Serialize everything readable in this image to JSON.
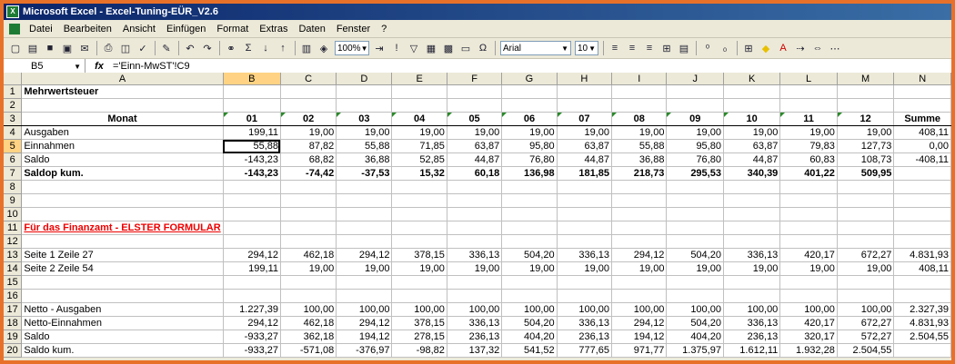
{
  "window": {
    "title": "Microsoft Excel - Excel-Tuning-EÜR_V2.6"
  },
  "menu": [
    "Datei",
    "Bearbeiten",
    "Ansicht",
    "Einfügen",
    "Format",
    "Extras",
    "Daten",
    "Fenster",
    "?"
  ],
  "toolbar": {
    "zoom": "100%",
    "font": "Arial",
    "font_size": "10"
  },
  "formula_bar": {
    "cell_ref": "B5",
    "fx": "fx",
    "formula": "='Einn-MwST'!C9"
  },
  "columns": [
    "A",
    "B",
    "C",
    "D",
    "E",
    "F",
    "G",
    "H",
    "I",
    "J",
    "K",
    "L",
    "M",
    "N"
  ],
  "selected": {
    "column": "B",
    "row": "5"
  },
  "rows": [
    {
      "n": "1",
      "cells": [
        "Mehrwertsteuer",
        "",
        "",
        "",
        "",
        "",
        "",
        "",
        "",
        "",
        "",
        "",
        "",
        ""
      ]
    },
    {
      "n": "2",
      "cells": [
        "",
        "",
        "",
        "",
        "",
        "",
        "",
        "",
        "",
        "",
        "",
        "",
        "",
        ""
      ]
    },
    {
      "n": "3",
      "cells": [
        "Monat",
        "01",
        "02",
        "03",
        "04",
        "05",
        "06",
        "07",
        "08",
        "09",
        "10",
        "11",
        "12",
        "Summe"
      ]
    },
    {
      "n": "4",
      "cells": [
        "Ausgaben",
        "199,11",
        "19,00",
        "19,00",
        "19,00",
        "19,00",
        "19,00",
        "19,00",
        "19,00",
        "19,00",
        "19,00",
        "19,00",
        "19,00",
        "408,11"
      ]
    },
    {
      "n": "5",
      "cells": [
        "Einnahmen",
        "55,88",
        "87,82",
        "55,88",
        "71,85",
        "63,87",
        "95,80",
        "63,87",
        "55,88",
        "95,80",
        "63,87",
        "79,83",
        "127,73",
        "0,00"
      ]
    },
    {
      "n": "6",
      "cells": [
        "Saldo",
        "-143,23",
        "68,82",
        "36,88",
        "52,85",
        "44,87",
        "76,80",
        "44,87",
        "36,88",
        "76,80",
        "44,87",
        "60,83",
        "108,73",
        "-408,11"
      ]
    },
    {
      "n": "7",
      "cells": [
        "Saldop kum.",
        "-143,23",
        "-74,42",
        "-37,53",
        "15,32",
        "60,18",
        "136,98",
        "181,85",
        "218,73",
        "295,53",
        "340,39",
        "401,22",
        "509,95",
        ""
      ]
    },
    {
      "n": "8",
      "cells": [
        "",
        "",
        "",
        "",
        "",
        "",
        "",
        "",
        "",
        "",
        "",
        "",
        "",
        ""
      ]
    },
    {
      "n": "9",
      "cells": [
        "",
        "",
        "",
        "",
        "",
        "",
        "",
        "",
        "",
        "",
        "",
        "",
        "",
        ""
      ]
    },
    {
      "n": "10",
      "cells": [
        "",
        "",
        "",
        "",
        "",
        "",
        "",
        "",
        "",
        "",
        "",
        "",
        "",
        ""
      ]
    },
    {
      "n": "11",
      "cells": [
        "Für das Finanzamt - ELSTER FORMULAR",
        "",
        "",
        "",
        "",
        "",
        "",
        "",
        "",
        "",
        "",
        "",
        "",
        ""
      ]
    },
    {
      "n": "12",
      "cells": [
        "",
        "",
        "",
        "",
        "",
        "",
        "",
        "",
        "",
        "",
        "",
        "",
        "",
        ""
      ]
    },
    {
      "n": "13",
      "cells": [
        "Seite 1 Zeile 27",
        "294,12",
        "462,18",
        "294,12",
        "378,15",
        "336,13",
        "504,20",
        "336,13",
        "294,12",
        "504,20",
        "336,13",
        "420,17",
        "672,27",
        "4.831,93"
      ]
    },
    {
      "n": "14",
      "cells": [
        "Seite 2 Zeile 54",
        "199,11",
        "19,00",
        "19,00",
        "19,00",
        "19,00",
        "19,00",
        "19,00",
        "19,00",
        "19,00",
        "19,00",
        "19,00",
        "19,00",
        "408,11"
      ]
    },
    {
      "n": "15",
      "cells": [
        "",
        "",
        "",
        "",
        "",
        "",
        "",
        "",
        "",
        "",
        "",
        "",
        "",
        ""
      ]
    },
    {
      "n": "16",
      "cells": [
        "",
        "",
        "",
        "",
        "",
        "",
        "",
        "",
        "",
        "",
        "",
        "",
        "",
        ""
      ]
    },
    {
      "n": "17",
      "cells": [
        "Netto - Ausgaben",
        "1.227,39",
        "100,00",
        "100,00",
        "100,00",
        "100,00",
        "100,00",
        "100,00",
        "100,00",
        "100,00",
        "100,00",
        "100,00",
        "100,00",
        "2.327,39"
      ]
    },
    {
      "n": "18",
      "cells": [
        "Netto-Einnahmen",
        "294,12",
        "462,18",
        "294,12",
        "378,15",
        "336,13",
        "504,20",
        "336,13",
        "294,12",
        "504,20",
        "336,13",
        "420,17",
        "672,27",
        "4.831,93"
      ]
    },
    {
      "n": "19",
      "cells": [
        "Saldo",
        "-933,27",
        "362,18",
        "194,12",
        "278,15",
        "236,13",
        "404,20",
        "236,13",
        "194,12",
        "404,20",
        "236,13",
        "320,17",
        "572,27",
        "2.504,55"
      ]
    },
    {
      "n": "20",
      "cells": [
        "Saldo kum.",
        "-933,27",
        "-571,08",
        "-376,97",
        "-98,82",
        "137,32",
        "541,52",
        "777,65",
        "971,77",
        "1.375,97",
        "1.612,11",
        "1.932,28",
        "2.504,55",
        ""
      ]
    }
  ]
}
